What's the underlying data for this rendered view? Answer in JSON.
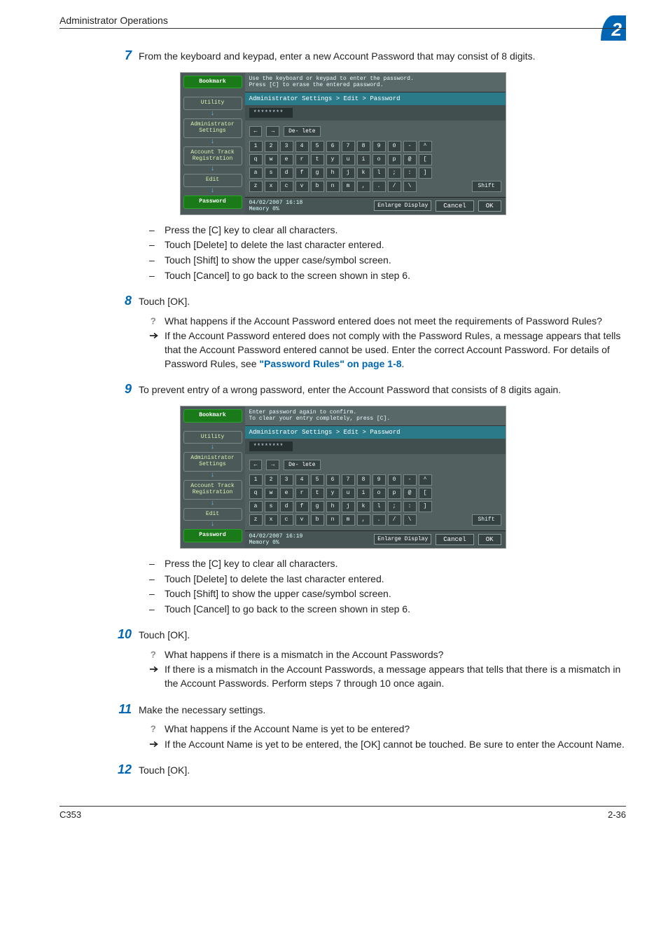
{
  "header": {
    "title": "Administrator Operations",
    "chapter_num": "2"
  },
  "steps": {
    "s7": {
      "num": "7",
      "text": "From the keyboard and keypad, enter a new Account Password that may consist of 8 digits."
    },
    "s7_sub": {
      "a": "Press the [C] key to clear all characters.",
      "b": "Touch [Delete] to delete the last character entered.",
      "c": "Touch [Shift] to show the upper case/symbol screen.",
      "d": "Touch [Cancel] to go back to the screen shown in step 6."
    },
    "s8": {
      "num": "8",
      "text": "Touch [OK]."
    },
    "s8_q": "What happens if the Account Password entered does not meet the requirements of Password Rules?",
    "s8_a_pre": "If the Account Password entered does not comply with the Password Rules, a message appears that tells that the Account Password entered cannot be used. Enter the correct Account Password. For details of Password Rules, see ",
    "s8_a_link": "\"Password Rules\" on page 1-8",
    "s8_a_post": ".",
    "s9": {
      "num": "9",
      "text": "To prevent entry of a wrong password, enter the Account Password that consists of 8 digits again."
    },
    "s9_sub": {
      "a": "Press the [C] key to clear all characters.",
      "b": "Touch [Delete] to delete the last character entered.",
      "c": "Touch [Shift] to show the upper case/symbol screen.",
      "d": "Touch [Cancel] to go back to the screen shown in step 6."
    },
    "s10": {
      "num": "10",
      "text": "Touch [OK]."
    },
    "s10_q": "What happens if there is a mismatch in the Account Passwords?",
    "s10_a": "If there is a mismatch in the Account Passwords, a message appears that tells that there is a mismatch in the Account Passwords. Perform steps 7 through 10 once again.",
    "s11": {
      "num": "11",
      "text": "Make the necessary settings."
    },
    "s11_q": "What happens if the Account Name is yet to be entered?",
    "s11_a": "If the Account Name is yet to be entered, the [OK] cannot be touched. Be sure to enter the Account Name.",
    "s12": {
      "num": "12",
      "text": "Touch [OK]."
    }
  },
  "shot1": {
    "instruction": "Use the keyboard or keypad to enter the password.\nPress [C] to erase the entered password.",
    "breadcrumb": "Administrator Settings > Edit > Password",
    "password_mask": "********",
    "tabs": {
      "bookmark": "Bookmark",
      "utility": "Utility",
      "admin": "Administrator\nSettings",
      "account": "Account Track\nRegistration",
      "edit": "Edit",
      "password": "Password"
    },
    "controls": {
      "left": "←",
      "right": "→",
      "delete": "De-\nlete"
    },
    "rows": {
      "r1": [
        "1",
        "2",
        "3",
        "4",
        "5",
        "6",
        "7",
        "8",
        "9",
        "0",
        "-",
        "^"
      ],
      "r2": [
        "q",
        "w",
        "e",
        "r",
        "t",
        "y",
        "u",
        "i",
        "o",
        "p",
        "@",
        "["
      ],
      "r3": [
        "a",
        "s",
        "d",
        "f",
        "g",
        "h",
        "j",
        "k",
        "l",
        ";",
        ":",
        "]"
      ],
      "r4": [
        "z",
        "x",
        "c",
        "v",
        "b",
        "n",
        "m",
        ",",
        ".",
        "/",
        "\\"
      ]
    },
    "shift": "Shift",
    "status": {
      "datetime": "04/02/2007   16:18",
      "memory": "Memory       0%",
      "enlarge": "Enlarge\nDisplay",
      "cancel": "Cancel",
      "ok": "OK"
    }
  },
  "shot2": {
    "instruction": "Enter password again to confirm.\nTo clear your entry completely, press [C].",
    "breadcrumb": "Administrator Settings > Edit > Password",
    "password_mask": "********",
    "tabs": {
      "bookmark": "Bookmark",
      "utility": "Utility",
      "admin": "Administrator\nSettings",
      "account": "Account Track\nRegistration",
      "edit": "Edit",
      "password": "Password"
    },
    "controls": {
      "left": "←",
      "right": "→",
      "delete": "De-\nlete"
    },
    "rows": {
      "r1": [
        "1",
        "2",
        "3",
        "4",
        "5",
        "6",
        "7",
        "8",
        "9",
        "0",
        "-",
        "^"
      ],
      "r2": [
        "q",
        "w",
        "e",
        "r",
        "t",
        "y",
        "u",
        "i",
        "o",
        "p",
        "@",
        "["
      ],
      "r3": [
        "a",
        "s",
        "d",
        "f",
        "g",
        "h",
        "j",
        "k",
        "l",
        ";",
        ":",
        "]"
      ],
      "r4": [
        "z",
        "x",
        "c",
        "v",
        "b",
        "n",
        "m",
        ",",
        ".",
        "/",
        "\\"
      ]
    },
    "shift": "Shift",
    "status": {
      "datetime": "04/02/2007   16:19",
      "memory": "Memory       0%",
      "enlarge": "Enlarge\nDisplay",
      "cancel": "Cancel",
      "ok": "OK"
    }
  },
  "footer": {
    "left": "C353",
    "right": "2-36"
  }
}
